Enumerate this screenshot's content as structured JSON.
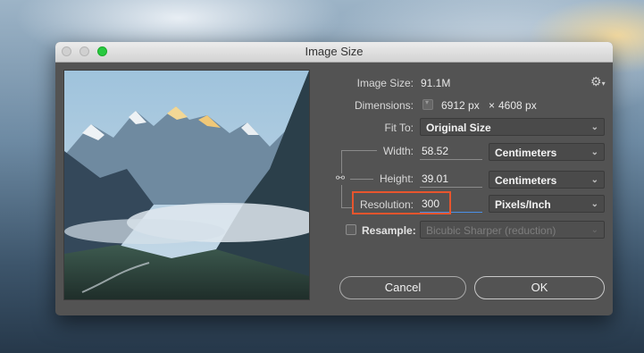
{
  "window": {
    "title": "Image Size"
  },
  "image_size": {
    "label": "Image Size:",
    "value": "91.1M"
  },
  "dimensions": {
    "label": "Dimensions:",
    "width": "6912 px",
    "separator": "×",
    "height": "4608 px"
  },
  "fit_to": {
    "label": "Fit To:",
    "selected": "Original Size"
  },
  "width": {
    "label": "Width:",
    "value": "58.52",
    "unit": "Centimeters"
  },
  "height": {
    "label": "Height:",
    "value": "39.01",
    "unit": "Centimeters"
  },
  "resolution": {
    "label": "Resolution:",
    "value": "300",
    "unit": "Pixels/Inch"
  },
  "resample": {
    "label": "Resample:",
    "checked": false,
    "method": "Bicubic Sharper (reduction)"
  },
  "buttons": {
    "cancel": "Cancel",
    "ok": "OK"
  },
  "icons": {
    "settings": "gear-icon",
    "dropdown": "chevron-down-icon",
    "link": "chain-link-icon",
    "dimensions_toggle": "dropdown-toggle-icon"
  },
  "colors": {
    "dialog_bg": "#535353",
    "highlight": "#e8552d",
    "focus_underline": "#4a8fe7"
  }
}
